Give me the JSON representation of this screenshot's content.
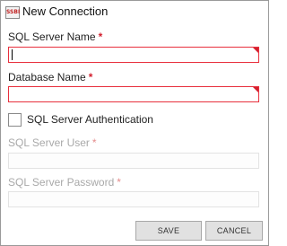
{
  "window": {
    "title": "New Connection",
    "app_icon_text": "SSBI"
  },
  "form": {
    "server_name": {
      "label": "SQL Server Name",
      "required_mark": "*",
      "value": ""
    },
    "database_name": {
      "label": "Database Name",
      "required_mark": "*",
      "value": ""
    },
    "auth": {
      "label": "SQL Server Authentication",
      "checked": false
    },
    "server_user": {
      "label": "SQL Server User",
      "required_mark": "*",
      "value": "",
      "disabled": true
    },
    "server_password": {
      "label": "SQL Server Password",
      "required_mark": "*",
      "value": "",
      "disabled": true
    }
  },
  "buttons": {
    "save_label": "SAVE",
    "cancel_label": "CANCEL"
  },
  "colors": {
    "required": "#d3202f",
    "error_border": "#e8303d",
    "button_bg": "#e1e1e1"
  }
}
